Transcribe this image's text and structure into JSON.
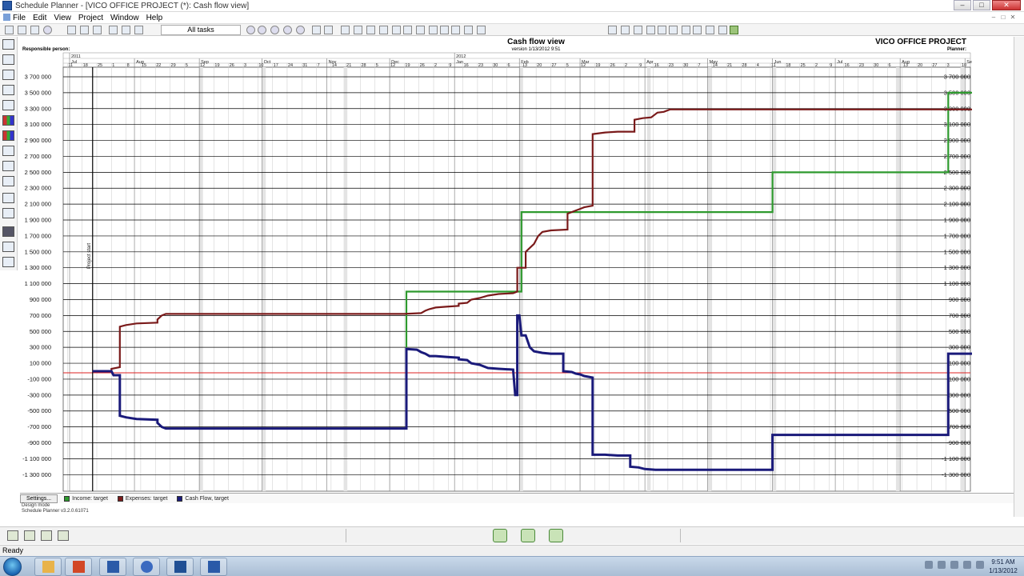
{
  "window": {
    "title": "Schedule Planner - [VICO OFFICE PROJECT (*): Cash flow view]",
    "controls": [
      "–",
      "□",
      "✕"
    ]
  },
  "menu": [
    "File",
    "Edit",
    "View",
    "Project",
    "Window",
    "Help"
  ],
  "toolbar": {
    "filter_value": "All tasks"
  },
  "header": {
    "view_title": "Cash flow view",
    "version": "version 1/13/2012 9:51",
    "project": "VICO OFFICE PROJECT",
    "responsible_label": "Responsible person:",
    "planner_label": "Planner:"
  },
  "timeline": {
    "years": [
      {
        "label": "2011",
        "day": 0
      },
      {
        "label": "2012",
        "day": 184
      }
    ],
    "months": [
      {
        "label": "Jul",
        "day": 0
      },
      {
        "label": "Aug",
        "day": 31
      },
      {
        "label": "Sep",
        "day": 62
      },
      {
        "label": "Oct",
        "day": 92
      },
      {
        "label": "Nov",
        "day": 123
      },
      {
        "label": "Dec",
        "day": 153
      },
      {
        "label": "Jan",
        "day": 184
      },
      {
        "label": "Feb",
        "day": 215
      },
      {
        "label": "Mar",
        "day": 244
      },
      {
        "label": "Apr",
        "day": 275
      },
      {
        "label": "May",
        "day": 305
      },
      {
        "label": "Jun",
        "day": 336
      },
      {
        "label": "Jul",
        "day": 366
      },
      {
        "label": "Aug",
        "day": 397
      },
      {
        "label": "Sep",
        "day": 428
      }
    ],
    "week_days": [
      "11",
      "18",
      "25",
      "1",
      "8",
      "15",
      "22",
      "29",
      "5",
      "12",
      "19",
      "26",
      "3",
      "10",
      "17",
      "24",
      "31",
      "7",
      "14",
      "21",
      "28",
      "5",
      "12",
      "19",
      "26",
      "2",
      "9",
      "16",
      "23",
      "30",
      "6",
      "13",
      "20",
      "27",
      "5",
      "12",
      "19",
      "26",
      "2",
      "9",
      "16",
      "23",
      "30",
      "7",
      "14",
      "21",
      "28",
      "4",
      "11",
      "18",
      "25",
      "2",
      "9",
      "16",
      "23",
      "30",
      "6",
      "13",
      "20",
      "27",
      "3",
      "10"
    ],
    "project_start_label": "Project start",
    "project_start_day": 11
  },
  "chart_data": {
    "type": "line",
    "title": "Cash flow view",
    "x_unit": "days since 2011-07-01",
    "ylim": [
      -1400000,
      3700000
    ],
    "y_ticks": [
      "3 700 000",
      "3 500 000",
      "3 300 000",
      "3 100 000",
      "2 900 000",
      "2 700 000",
      "2 500 000",
      "2 300 000",
      "2 100 000",
      "1 900 000",
      "1 700 000",
      "1 500 000",
      "1 300 000",
      "1 100 000",
      "900 000",
      "700 000",
      "500 000",
      "300 000",
      "100 000",
      "-100 000",
      "-300 000",
      "-500 000",
      "-700 000",
      "-900 000",
      "-1 100 000",
      "-1 300 000"
    ],
    "y_values": [
      3700000,
      3500000,
      3300000,
      3100000,
      2900000,
      2700000,
      2500000,
      2300000,
      2100000,
      1900000,
      1700000,
      1500000,
      1300000,
      1100000,
      900000,
      700000,
      500000,
      300000,
      100000,
      -100000,
      -300000,
      -500000,
      -700000,
      -900000,
      -1100000,
      -1300000
    ],
    "zero_line": 0,
    "series": [
      {
        "name": "Income: target",
        "color": "#2e9a2e",
        "points": [
          [
            161,
            300000
          ],
          [
            161,
            1000000
          ],
          [
            216,
            1000000
          ],
          [
            216,
            2000000
          ],
          [
            336,
            2000000
          ],
          [
            336,
            2500000
          ],
          [
            420,
            2500000
          ],
          [
            420,
            3500000
          ],
          [
            432,
            3500000
          ]
        ]
      },
      {
        "name": "Expenses: target",
        "color": "#7a1a1a",
        "points": [
          [
            11,
            0
          ],
          [
            20,
            0
          ],
          [
            20,
            30000
          ],
          [
            24,
            50000
          ],
          [
            24,
            560000
          ],
          [
            27,
            580000
          ],
          [
            32,
            600000
          ],
          [
            42,
            610000
          ],
          [
            42,
            650000
          ],
          [
            44,
            700000
          ],
          [
            46,
            720000
          ],
          [
            160,
            720000
          ],
          [
            168,
            730000
          ],
          [
            170,
            760000
          ],
          [
            172,
            780000
          ],
          [
            175,
            800000
          ],
          [
            180,
            810000
          ],
          [
            186,
            820000
          ],
          [
            186,
            850000
          ],
          [
            190,
            860000
          ],
          [
            192,
            900000
          ],
          [
            196,
            920000
          ],
          [
            200,
            950000
          ],
          [
            205,
            970000
          ],
          [
            212,
            980000
          ],
          [
            214,
            1000000
          ],
          [
            214,
            1300000
          ],
          [
            218,
            1300000
          ],
          [
            218,
            1500000
          ],
          [
            220,
            1550000
          ],
          [
            222,
            1600000
          ],
          [
            224,
            1700000
          ],
          [
            226,
            1750000
          ],
          [
            230,
            1770000
          ],
          [
            238,
            1780000
          ],
          [
            238,
            1980000
          ],
          [
            240,
            2000000
          ],
          [
            242,
            2020000
          ],
          [
            244,
            2040000
          ],
          [
            246,
            2060000
          ],
          [
            250,
            2080000
          ],
          [
            250,
            2980000
          ],
          [
            256,
            3000000
          ],
          [
            262,
            3010000
          ],
          [
            270,
            3010000
          ],
          [
            270,
            3160000
          ],
          [
            274,
            3180000
          ],
          [
            278,
            3190000
          ],
          [
            281,
            3250000
          ],
          [
            284,
            3260000
          ],
          [
            287,
            3290000
          ],
          [
            432,
            3290000
          ]
        ]
      },
      {
        "name": "Cash Flow, target",
        "color": "#1a1a7a",
        "points": [
          [
            11,
            0
          ],
          [
            20,
            0
          ],
          [
            21,
            -50000
          ],
          [
            24,
            -50000
          ],
          [
            24,
            -560000
          ],
          [
            27,
            -580000
          ],
          [
            32,
            -600000
          ],
          [
            42,
            -610000
          ],
          [
            42,
            -650000
          ],
          [
            44,
            -700000
          ],
          [
            46,
            -720000
          ],
          [
            160,
            -720000
          ],
          [
            161,
            -720000
          ],
          [
            161,
            280000
          ],
          [
            166,
            270000
          ],
          [
            168,
            240000
          ],
          [
            170,
            220000
          ],
          [
            172,
            190000
          ],
          [
            175,
            190000
          ],
          [
            180,
            180000
          ],
          [
            186,
            170000
          ],
          [
            186,
            150000
          ],
          [
            190,
            140000
          ],
          [
            192,
            100000
          ],
          [
            196,
            80000
          ],
          [
            200,
            40000
          ],
          [
            205,
            30000
          ],
          [
            212,
            20000
          ],
          [
            213,
            -300000
          ],
          [
            214,
            -300000
          ],
          [
            214,
            700000
          ],
          [
            215,
            700000
          ],
          [
            216,
            450000
          ],
          [
            218,
            450000
          ],
          [
            220,
            300000
          ],
          [
            222,
            250000
          ],
          [
            226,
            230000
          ],
          [
            230,
            220000
          ],
          [
            236,
            220000
          ],
          [
            236,
            0
          ],
          [
            240,
            -10000
          ],
          [
            242,
            -30000
          ],
          [
            244,
            -40000
          ],
          [
            246,
            -60000
          ],
          [
            250,
            -80000
          ],
          [
            250,
            -1050000
          ],
          [
            256,
            -1050000
          ],
          [
            262,
            -1060000
          ],
          [
            268,
            -1060000
          ],
          [
            268,
            -1200000
          ],
          [
            272,
            -1210000
          ],
          [
            275,
            -1230000
          ],
          [
            280,
            -1240000
          ],
          [
            336,
            -1240000
          ],
          [
            336,
            -800000
          ],
          [
            420,
            -800000
          ],
          [
            420,
            220000
          ],
          [
            432,
            220000
          ]
        ]
      }
    ]
  },
  "legend": {
    "settings_label": "Settings...",
    "items": [
      {
        "label": "Income: target",
        "color": "#2e9a2e"
      },
      {
        "label": "Expenses: target",
        "color": "#7a1a1a"
      },
      {
        "label": "Cash Flow, target",
        "color": "#1a1a7a"
      }
    ]
  },
  "footer_info": {
    "mode": "Design mode",
    "version": "Schedule Planner v3.2.0.61071"
  },
  "status": {
    "text": "Ready"
  },
  "taskbar": {
    "time": "9:51 AM",
    "date": "1/13/2012"
  }
}
